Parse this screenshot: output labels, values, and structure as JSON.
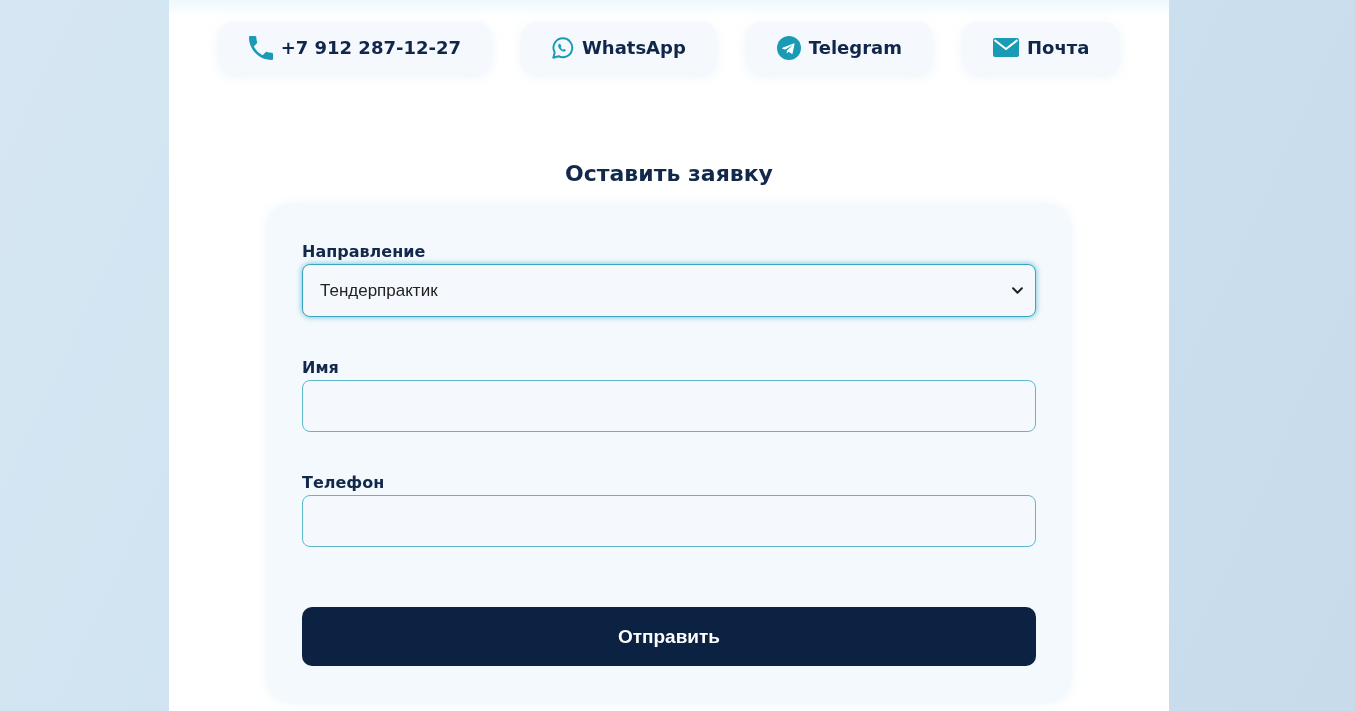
{
  "contacts": [
    {
      "kind": "phone",
      "label": "+7 912 287-12-27"
    },
    {
      "kind": "whatsapp",
      "label": "WhatsApp"
    },
    {
      "kind": "telegram",
      "label": "Telegram"
    },
    {
      "kind": "mail",
      "label": "Почта"
    }
  ],
  "form": {
    "title": "Оставить заявку",
    "fields": [
      {
        "kind": "select",
        "label": "Направление",
        "value": "Тендерпрактик",
        "focused": true
      },
      {
        "kind": "text",
        "label": "Имя",
        "focused": false
      },
      {
        "kind": "text",
        "label": "Телефон",
        "focused": false
      }
    ],
    "submit": "Отправить"
  }
}
